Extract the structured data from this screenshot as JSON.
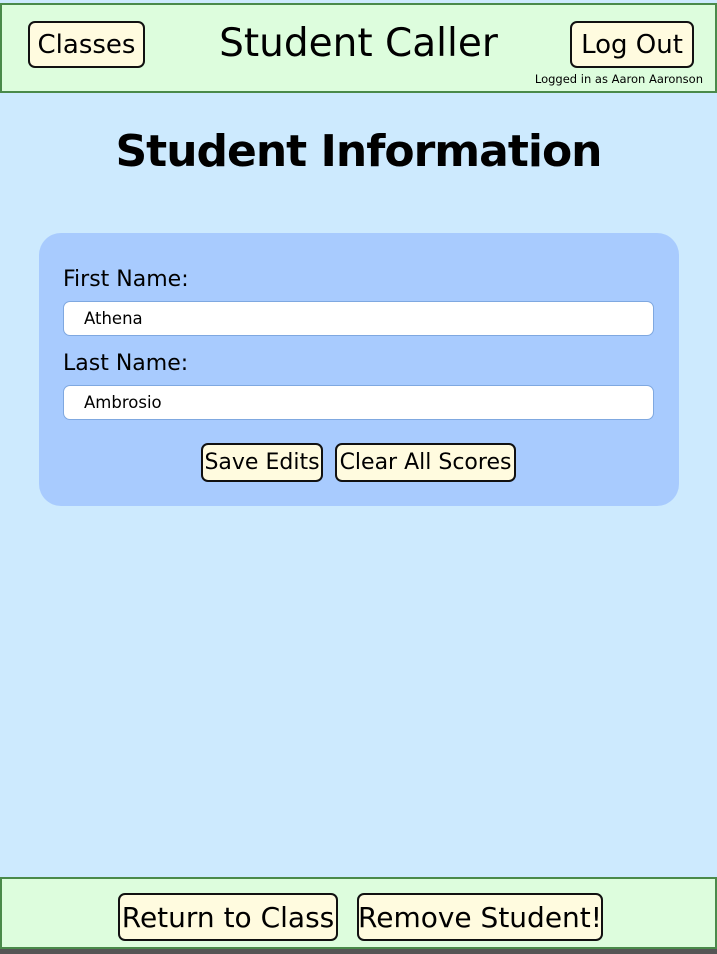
{
  "header": {
    "classes_label": "Classes",
    "app_title": "Student Caller",
    "logout_label": "Log Out",
    "logged_in_text": "Logged in as Aaron Aaronson"
  },
  "main": {
    "page_title": "Student Information",
    "form": {
      "first_name_label": "First Name:",
      "first_name_value": "Athena",
      "last_name_label": "Last Name:",
      "last_name_value": "Ambrosio",
      "save_label": "Save Edits",
      "clear_label": "Clear All Scores"
    }
  },
  "footer": {
    "return_label": "Return to Class",
    "remove_label": "Remove Student!"
  },
  "colors": {
    "page_background": "#cdeafe",
    "bar_background": "#ddfddd",
    "bar_border": "#4a8a4a",
    "card_background": "#a8cbfe",
    "button_background": "#fffbdf"
  }
}
